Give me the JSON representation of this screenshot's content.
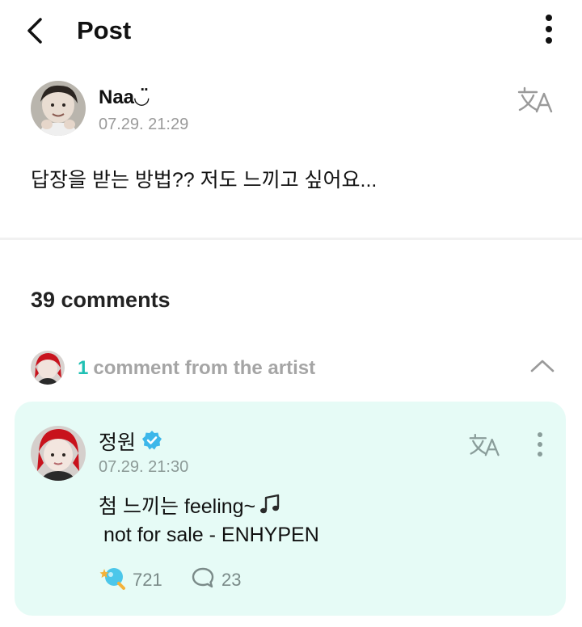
{
  "header": {
    "title": "Post"
  },
  "post": {
    "author_name": "Naa◡̈",
    "timestamp": "07.29. 21:29",
    "text": "답장을 받는 방법?? 저도 느끼고 싶어요..."
  },
  "comments": {
    "count_label": "39 comments"
  },
  "artist_section": {
    "count": "1",
    "label": "comment from the artist"
  },
  "artist_comment": {
    "name": "정원",
    "timestamp": "07.29. 21:30",
    "line1": "첨 느끼는 feeling~",
    "line2": "not for sale - ENHYPEN",
    "like_count": "721",
    "comment_count": "23"
  },
  "icons": [
    "back-icon",
    "more-icon",
    "translate-icon",
    "chevron-up-icon",
    "verified-icon",
    "music-note-icon",
    "like-icon",
    "comment-icon"
  ],
  "colors": {
    "accent": "#20c0b4",
    "card_background": "#e6fbf6",
    "verified": "#3db7ea",
    "muted_text": "#a5a5a5"
  }
}
